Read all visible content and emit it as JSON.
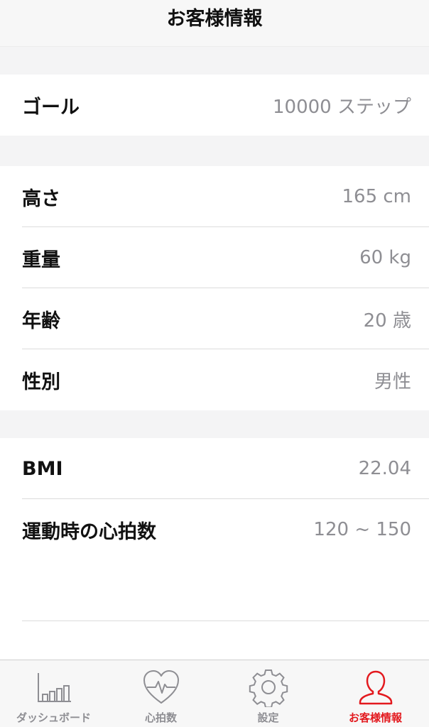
{
  "header": {
    "title": "お客様情報"
  },
  "goal": {
    "label": "ゴール",
    "value": "10000 ステップ"
  },
  "profile": [
    {
      "label": "高さ",
      "value": "165 cm"
    },
    {
      "label": "重量",
      "value": "60 kg"
    },
    {
      "label": "年齢",
      "value": "20 歳"
    },
    {
      "label": "性別",
      "value": "男性"
    }
  ],
  "stats": [
    {
      "label": "BMI",
      "value": "22.04"
    },
    {
      "label": "運動時の心拍数",
      "value": "120 ~ 150"
    }
  ],
  "tabs": [
    {
      "label": "ダッシュボード",
      "icon": "bar-chart-icon",
      "active": false
    },
    {
      "label": "心拍数",
      "icon": "heart-rate-icon",
      "active": false
    },
    {
      "label": "設定",
      "icon": "gear-icon",
      "active": false
    },
    {
      "label": "お客様情報",
      "icon": "user-icon",
      "active": true
    }
  ],
  "colors": {
    "accent": "#e3191e",
    "inactive": "#8e8e93",
    "background": "#f4f4f5"
  }
}
